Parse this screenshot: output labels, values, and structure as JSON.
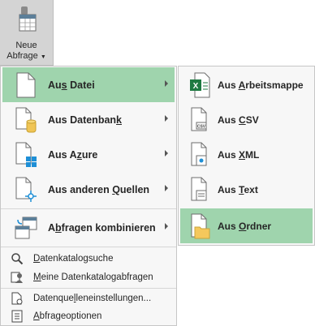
{
  "ribbon": {
    "new_query_line1": "Neue",
    "new_query_line2": "Abfrage",
    "new_query_icon": "database-table-icon"
  },
  "menu": {
    "items": [
      {
        "pre": "Au",
        "acc": "s",
        "post": " Datei",
        "icon": "file-icon"
      },
      {
        "pre": "Aus Datenban",
        "acc": "k",
        "post": "",
        "icon": "database-file-icon"
      },
      {
        "pre": "Aus A",
        "acc": "z",
        "post": "ure",
        "icon": "azure-file-icon"
      },
      {
        "pre": "Aus anderen ",
        "acc": "Q",
        "post": "uellen",
        "icon": "other-source-icon"
      },
      {
        "pre": "A",
        "acc": "b",
        "post": "fragen kombinieren",
        "icon": "combine-icon"
      }
    ],
    "small_items": [
      {
        "pre": "",
        "acc": "D",
        "post": "atenkatalogsuche",
        "icon": "catalog-search-icon"
      },
      {
        "pre": "",
        "acc": "M",
        "post": "eine Datenkatalogabfragen",
        "icon": "my-catalog-icon"
      },
      {
        "pre": "Datenque",
        "acc": "l",
        "post": "leneinstellungen...",
        "icon": "datasource-settings-icon"
      },
      {
        "pre": "",
        "acc": "A",
        "post": "bfrageoptionen",
        "icon": "query-options-icon"
      }
    ]
  },
  "submenu": {
    "items": [
      {
        "pre": "Aus ",
        "acc": "A",
        "post": "rbeitsmappe",
        "icon": "excel-icon"
      },
      {
        "pre": "Aus ",
        "acc": "C",
        "post": "SV",
        "icon": "csv-icon"
      },
      {
        "pre": "Aus ",
        "acc": "X",
        "post": "ML",
        "icon": "xml-icon"
      },
      {
        "pre": "Aus ",
        "acc": "T",
        "post": "ext",
        "icon": "text-file-icon"
      },
      {
        "pre": "Aus ",
        "acc": "O",
        "post": "rdner",
        "icon": "folder-icon"
      }
    ]
  },
  "colors": {
    "selection": "#9fd4ad",
    "menu_bg": "#f7f7f7",
    "ribbon_bg": "#d4d4d4"
  }
}
